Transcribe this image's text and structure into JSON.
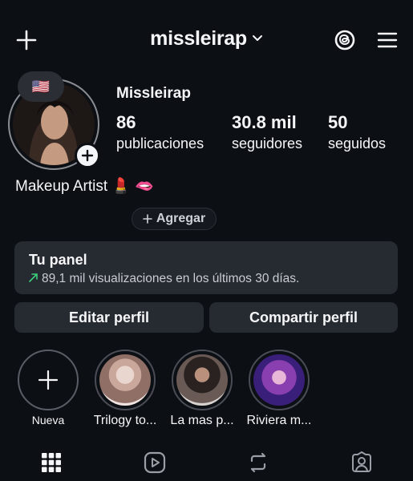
{
  "header": {
    "username": "missleirap",
    "chevron_icon": "chevron-down-icon",
    "left_icon": "plus-icon",
    "right_icons": [
      "threads-icon",
      "hamburger-menu-icon"
    ]
  },
  "profile": {
    "note_emoji": "🇺🇸",
    "display_name": "Missleirap",
    "stats": [
      {
        "value": "86",
        "label": "publicaciones"
      },
      {
        "value": "30.8 mil",
        "label": "seguidores"
      },
      {
        "value": "50",
        "label": "seguidos"
      }
    ],
    "bio": "Makeup Artist 💄 🫦",
    "add_link_label": "Agregar"
  },
  "panel": {
    "title": "Tu panel",
    "subtitle": "89,1 mil visualizaciones en los últimos 30 días."
  },
  "actions": {
    "edit_label": "Editar perfil",
    "share_label": "Compartir perfil"
  },
  "highlights": [
    {
      "label": "Nueva",
      "type": "new"
    },
    {
      "label": "Trilogy to...",
      "type": "story"
    },
    {
      "label": "La mas p...",
      "type": "story"
    },
    {
      "label": "Riviera m...",
      "type": "story"
    }
  ],
  "tabs": [
    "grid-icon",
    "reels-icon",
    "reposts-icon",
    "tagged-icon"
  ],
  "colors": {
    "background": "#0c0f14",
    "card": "#262a31",
    "trend_green": "#3ad07a"
  }
}
